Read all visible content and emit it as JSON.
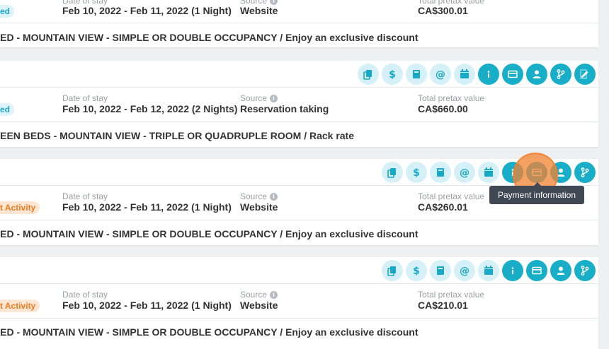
{
  "labels": {
    "date_of_stay": "Date of stay",
    "source": "Source",
    "total_pretax": "Total pretax value"
  },
  "tooltip": "Payment information",
  "bookings": [
    {
      "status": "ed",
      "status_color": "blue",
      "date": "Feb 10, 2022 - Feb 11, 2022 (1 Night)",
      "source": "Website",
      "total": "CA$300.01",
      "description": "BED - MOUNTAIN VIEW - SIMPLE OR DOUBLE OCCUPANCY / Enjoy an exclusive discount"
    },
    {
      "status": "ed",
      "status_color": "blue",
      "date": "Feb 10, 2022 - Feb 12, 2022 (2 Nights)",
      "source": "Reservation taking",
      "total": "CA$660.00",
      "description": "UEEN BEDS - MOUNTAIN VIEW - TRIPLE OR QUADRUPLE ROOM / Rack rate"
    },
    {
      "status": "t Activity",
      "status_color": "orange",
      "date": "Feb 10, 2022 - Feb 11, 2022 (1 Night)",
      "source": "Website",
      "total": "CA$260.01",
      "description": "BED - MOUNTAIN VIEW - SIMPLE OR DOUBLE OCCUPANCY / Enjoy an exclusive discount"
    },
    {
      "status": "t Activity",
      "status_color": "orange",
      "date": "Feb 10, 2022 - Feb 11, 2022 (1 Night)",
      "source": "Website",
      "total": "CA$210.01",
      "description": "BED - MOUNTAIN VIEW - SIMPLE OR DOUBLE OCCUPANCY / Enjoy an exclusive discount"
    }
  ],
  "action_icons": [
    "copy-icon",
    "dollar-icon",
    "book-icon",
    "at-icon",
    "calendar-icon",
    "info-icon",
    "credit-card-icon",
    "user-icon",
    "branch-icon",
    "edit-icon"
  ],
  "colors": {
    "accent": "#18aec8",
    "accent_soft": "#d5f1f7",
    "orange": "#f07a1f",
    "tooltip_bg": "#404854"
  }
}
